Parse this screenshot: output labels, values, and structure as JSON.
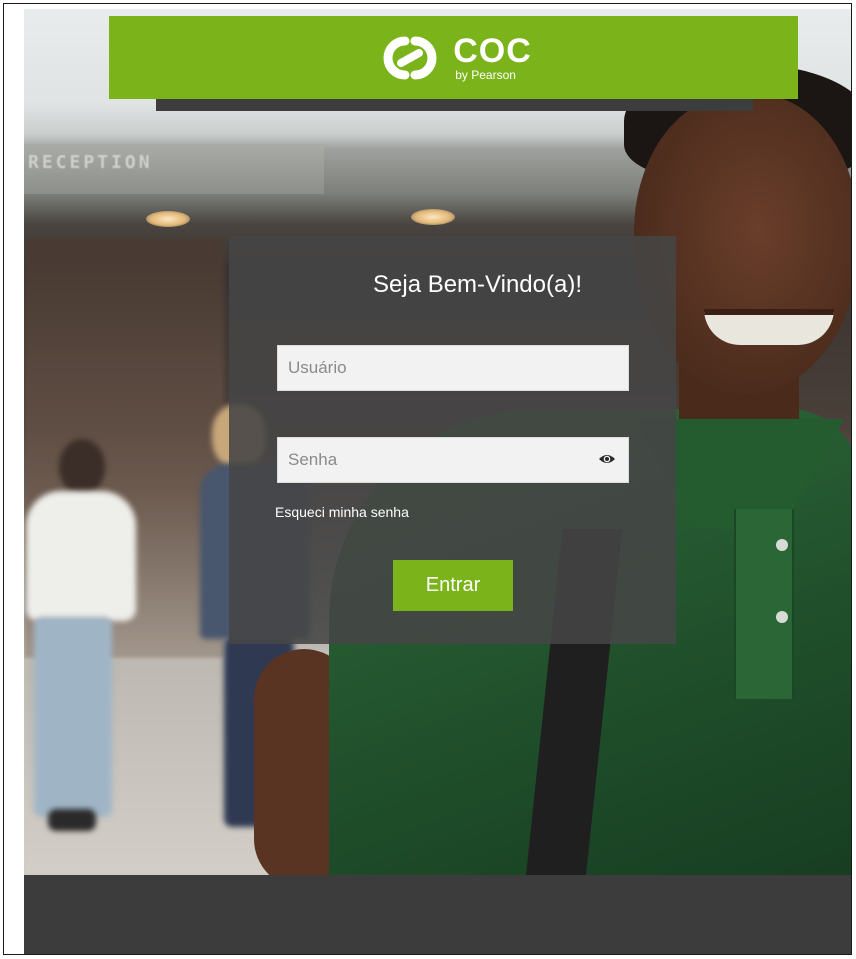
{
  "brand": {
    "name": "COC",
    "tagline": "by Pearson",
    "logo_icon": "coc-logo-icon",
    "accent_color": "#7bb31a"
  },
  "background": {
    "sign_text": "RECEPTION"
  },
  "login": {
    "title": "Seja Bem-Vindo(a)!",
    "username": {
      "value": "",
      "placeholder": "Usuário"
    },
    "password": {
      "value": "",
      "placeholder": "Senha",
      "toggle_icon": "eye-icon"
    },
    "forgot_link": "Esqueci minha senha",
    "submit_label": "Entrar"
  },
  "colors": {
    "panel_bg": "#464646",
    "footer_bg": "#3c3c3c",
    "button_bg": "#7bb31a"
  }
}
